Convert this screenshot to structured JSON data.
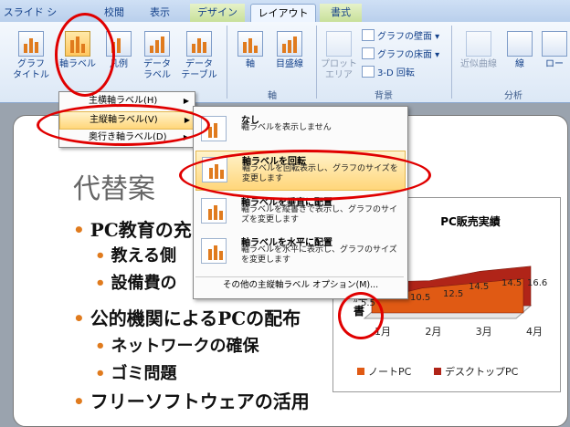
{
  "tabs": [
    {
      "label": "スライド ショー",
      "state": "normal"
    },
    {
      "label": "校閲",
      "state": "normal"
    },
    {
      "label": "表示",
      "state": "normal"
    },
    {
      "label": "デザイン",
      "state": "context"
    },
    {
      "label": "レイアウト",
      "state": "active"
    },
    {
      "label": "書式",
      "state": "context"
    }
  ],
  "ribbon": {
    "labels_group": {
      "chart_title": "グラフ\nタイトル",
      "axis_title": "軸ラベル",
      "legend": "凡例",
      "data_labels": "データ\nラベル",
      "data_table": "データ\nテーブル"
    },
    "axes_group": {
      "label": "軸",
      "axes": "軸",
      "gridlines": "目盛線"
    },
    "background_group": {
      "label": "背景",
      "plot_area": "プロット\nエリア",
      "chart_wall": "グラフの壁面",
      "chart_floor": "グラフの床面",
      "rotation_3d": "3-D 回転"
    },
    "analysis_group": {
      "label": "分析",
      "trendline": "近似曲線",
      "lines": "線",
      "updown": "ロー"
    }
  },
  "menu1": [
    {
      "label": "主横軸ラベル(H)",
      "highlighted": false
    },
    {
      "label": "主縦軸ラベル(V)",
      "highlighted": true
    },
    {
      "label": "奥行き軸ラベル(D)",
      "highlighted": false
    }
  ],
  "menu2": {
    "items": [
      {
        "title": "なし",
        "desc": "軸ラベルを表示しません",
        "highlighted": false
      },
      {
        "title": "軸ラベルを回転",
        "desc": "軸ラベルを回転表示し、グラフのサイズを変更します",
        "highlighted": true
      },
      {
        "title": "軸ラベルを垂直に配置",
        "desc": "軸ラベルを縦書きで表示し、グラフのサイズを変更します",
        "highlighted": false
      },
      {
        "title": "軸ラベルを水平に配置",
        "desc": "軸ラベルを水平に表示し、グラフのサイズを変更します",
        "highlighted": false
      }
    ],
    "options": "その他の主縦軸ラベル オプション(M)..."
  },
  "slide": {
    "title": "代替案",
    "bullets": [
      {
        "text": "PC教育の充",
        "level": 1
      },
      {
        "text": "教える側",
        "level": 2
      },
      {
        "text": "設備費の",
        "level": 2
      },
      {
        "text": "公的機関によるPCの配布",
        "level": 1
      },
      {
        "text": "ネットワークの確保",
        "level": 2
      },
      {
        "text": "ゴミ問題",
        "level": 2
      },
      {
        "text": "フリーソフトウェアの活用",
        "level": 1
      }
    ]
  },
  "chart_data": {
    "type": "area",
    "title": "PC販売実績",
    "categories": [
      "1月",
      "2月",
      "3月",
      "4月"
    ],
    "series": [
      {
        "name": "ノートPC",
        "values": [
          5.5,
          10.5,
          12.5,
          14.5
        ],
        "color": "#e05a14"
      },
      {
        "name": "デスクトップPC",
        "values": [
          10,
          10.5,
          14.5,
          16.6
        ],
        "color": "#b02418"
      }
    ],
    "axis_label_text": "ｶﾞﾞ",
    "axis_label_glyph": "書",
    "legend": "bottom",
    "data_labels": [
      "10",
      "5.5",
      "10.5",
      "12.5",
      "14.5",
      "14.5",
      "16.6"
    ]
  },
  "annotation": {
    "color": "#e00000"
  }
}
